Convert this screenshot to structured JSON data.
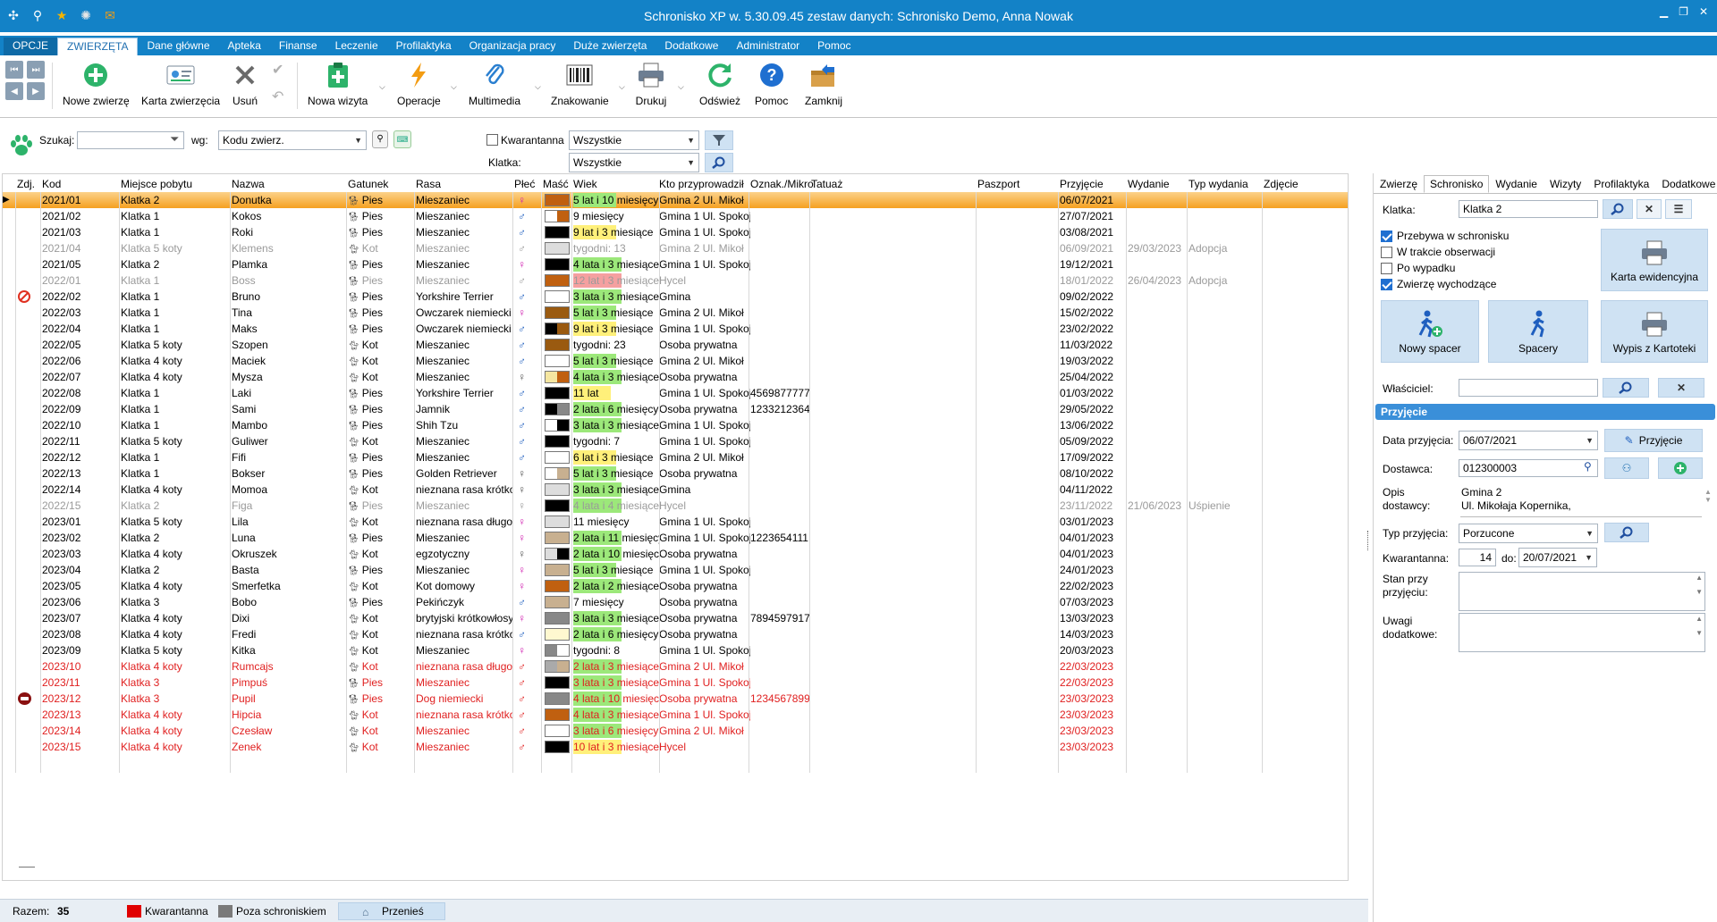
{
  "window": {
    "title": "Schronisko XP w. 5.30.09.45 zestaw danych: Schronisko Demo, Anna Nowak",
    "quick_icons": [
      "app-logo-icon",
      "search-icon",
      "star-icon",
      "settings-icon",
      "mail-icon"
    ]
  },
  "menu": {
    "tabs": [
      "OPCJE",
      "ZWIERZĘTA",
      "Dane główne",
      "Apteka",
      "Finanse",
      "Leczenie",
      "Profilaktyka",
      "Organizacja pracy",
      "Duże zwierzęta",
      "Dodatkowe",
      "Administrator",
      "Pomoc"
    ],
    "active": "ZWIERZĘTA"
  },
  "ribbon": {
    "new_animal": "Nowe zwierzę",
    "animal_card": "Karta zwierzęcia",
    "delete": "Usuń",
    "new_visit": "Nowa wizyta",
    "operations": "Operacje",
    "multimedia": "Multimedia",
    "labeling": "Znakowanie",
    "print": "Drukuj",
    "refresh": "Odśwież",
    "help": "Pomoc",
    "close": "Zamknij"
  },
  "search": {
    "search_label": "Szukaj:",
    "search_value": "",
    "by_label": "wg:",
    "by_value": "Kodu zwierz.",
    "quarantine_label": "Kwarantanna",
    "quarantine_value": "Wszystkie",
    "cage_label": "Klatka:",
    "cage_value": "Wszystkie"
  },
  "grid": {
    "columns": [
      "Zdj.",
      "Kod",
      "Miejsce pobytu",
      "Nazwa",
      "Gatunek",
      "Rasa",
      "Płeć",
      "Maść",
      "Wiek",
      "Kto przyprowadził",
      "Oznak./Mikro",
      "Tatuaż",
      "Paszport",
      "Przyjęcie",
      "Wydanie",
      "Typ wydania",
      "Zdjęcie"
    ],
    "rows": [
      {
        "kod": "2021/01",
        "miejsce": "Klatka 2",
        "nazwa": "Donutka",
        "gatunek": "Pies",
        "rasa": "Mieszaniec",
        "plec": "f",
        "masc": [
          "#c06010",
          "#c06010"
        ],
        "wiek": "5 lat i 10 miesięcy",
        "kto": "Gmina 2  Ul. Mikoł",
        "oznak": "",
        "przyjecie": "06/07/2021",
        "wydanie": "",
        "typ": "",
        "state": "sel",
        "icon": ""
      },
      {
        "kod": "2021/02",
        "miejsce": "Klatka 1",
        "nazwa": "Kokos",
        "gatunek": "Pies",
        "rasa": "Mieszaniec",
        "plec": "m",
        "masc": [
          "#ffffff",
          "#c06010"
        ],
        "wiek": "9 miesięcy",
        "kto": "Gmina 1  Ul. Spokoj",
        "oznak": "",
        "przyjecie": "27/07/2021",
        "wydanie": "",
        "typ": "",
        "state": "",
        "icon": ""
      },
      {
        "kod": "2021/03",
        "miejsce": "Klatka 1",
        "nazwa": "Roki",
        "gatunek": "Pies",
        "rasa": "Mieszaniec",
        "plec": "m",
        "masc": [
          "#000000",
          "#000000"
        ],
        "wiek": "9 lat i 3 miesiące",
        "kto": "Gmina 1  Ul. Spokoj",
        "oznak": "",
        "przyjecie": "03/08/2021",
        "wydanie": "",
        "typ": "",
        "state": "",
        "icon": ""
      },
      {
        "kod": "2021/04",
        "miejsce": "Klatka 5 koty",
        "nazwa": "Klemens",
        "gatunek": "Kot",
        "rasa": "Mieszaniec",
        "plec": "m",
        "masc": [
          "#dddddd",
          "#dddddd"
        ],
        "wiek": "tygodni: 13",
        "kto": "Gmina 2  Ul. Mikoł",
        "oznak": "",
        "przyjecie": "06/09/2021",
        "wydanie": "29/03/2023",
        "typ": "Adopcja",
        "state": "gray",
        "icon": ""
      },
      {
        "kod": "2021/05",
        "miejsce": "Klatka 2",
        "nazwa": "Plamka",
        "gatunek": "Pies",
        "rasa": "Mieszaniec",
        "plec": "f",
        "masc": [
          "#000000",
          "#000000"
        ],
        "wiek": "4 lata i 3 miesiące",
        "kto": "Gmina 1  Ul. Spokoj",
        "oznak": "",
        "przyjecie": "19/12/2021",
        "wydanie": "",
        "typ": "",
        "state": "",
        "icon": ""
      },
      {
        "kod": "2022/01",
        "miejsce": "Klatka 1",
        "nazwa": "Boss",
        "gatunek": "Pies",
        "rasa": "Mieszaniec",
        "plec": "m",
        "masc": [
          "#c06010",
          "#c06010"
        ],
        "wiek": "12 lat i 3 miesiące",
        "kto": "Hycel",
        "oznak": "",
        "przyjecie": "18/01/2022",
        "wydanie": "26/04/2023",
        "typ": "Adopcja",
        "state": "gray",
        "icon": ""
      },
      {
        "kod": "2022/02",
        "miejsce": "Klatka 1",
        "nazwa": "Bruno",
        "gatunek": "Pies",
        "rasa": "Yorkshire Terrier",
        "plec": "m",
        "masc": [
          "#ffffff",
          "#ffffff"
        ],
        "wiek": "3 lata i 3 miesiące",
        "kto": "Gmina",
        "oznak": "",
        "przyjecie": "09/02/2022",
        "wydanie": "",
        "typ": "",
        "state": "",
        "icon": "no"
      },
      {
        "kod": "2022/03",
        "miejsce": "Klatka 1",
        "nazwa": "Tina",
        "gatunek": "Pies",
        "rasa": "Owczarek niemiecki",
        "plec": "f",
        "masc": [
          "#9a5a10",
          "#9a5a10"
        ],
        "wiek": "5 lat i 3 miesiące",
        "kto": "Gmina 2  Ul. Mikoł",
        "oznak": "",
        "przyjecie": "15/02/2022",
        "wydanie": "",
        "typ": "",
        "state": "",
        "icon": ""
      },
      {
        "kod": "2022/04",
        "miejsce": "Klatka 1",
        "nazwa": "Maks",
        "gatunek": "Pies",
        "rasa": "Owczarek niemiecki",
        "plec": "m",
        "masc": [
          "#000000",
          "#9a5a10"
        ],
        "wiek": "9 lat i 3 miesiące",
        "kto": "Gmina 1  Ul. Spokoj",
        "oznak": "",
        "przyjecie": "23/02/2022",
        "wydanie": "",
        "typ": "",
        "state": "",
        "icon": ""
      },
      {
        "kod": "2022/05",
        "miejsce": "Klatka 5 koty",
        "nazwa": "Szopen",
        "gatunek": "Kot",
        "rasa": "Mieszaniec",
        "plec": "m",
        "masc": [
          "#9a5a10",
          "#9a5a10"
        ],
        "wiek": "tygodni: 23",
        "kto": "Osoba prywatna",
        "oznak": "",
        "przyjecie": "11/03/2022",
        "wydanie": "",
        "typ": "",
        "state": "",
        "icon": ""
      },
      {
        "kod": "2022/06",
        "miejsce": "Klatka 4 koty",
        "nazwa": "Maciek",
        "gatunek": "Kot",
        "rasa": "Mieszaniec",
        "plec": "m",
        "masc": [
          "#ffffff",
          "#ffffff"
        ],
        "wiek": "5 lat i 3 miesiące",
        "kto": "Gmina 2  Ul. Mikoł",
        "oznak": "",
        "przyjecie": "19/03/2022",
        "wydanie": "",
        "typ": "",
        "state": "",
        "icon": ""
      },
      {
        "kod": "2022/07",
        "miejsce": "Klatka 4 koty",
        "nazwa": "Mysza",
        "gatunek": "Kot",
        "rasa": "Mieszaniec",
        "plec": "u",
        "masc": [
          "#f5e6a0",
          "#c06010"
        ],
        "wiek": "4 lata i 3 miesiące",
        "kto": "Osoba prywatna",
        "oznak": "",
        "przyjecie": "25/04/2022",
        "wydanie": "",
        "typ": "",
        "state": "",
        "icon": ""
      },
      {
        "kod": "2022/08",
        "miejsce": "Klatka 1",
        "nazwa": "Laki",
        "gatunek": "Pies",
        "rasa": "Yorkshire Terrier",
        "plec": "m",
        "masc": [
          "#000000",
          "#000000"
        ],
        "wiek": "11 lat",
        "kto": "Gmina 1  Ul. Spokoj",
        "oznak": "4569877777",
        "przyjecie": "01/03/2022",
        "wydanie": "",
        "typ": "",
        "state": "",
        "icon": ""
      },
      {
        "kod": "2022/09",
        "miejsce": "Klatka 1",
        "nazwa": "Sami",
        "gatunek": "Pies",
        "rasa": "Jamnik",
        "plec": "m",
        "masc": [
          "#000000",
          "#888888"
        ],
        "wiek": "2 lata i 6 miesięcy",
        "kto": "Osoba prywatna",
        "oznak": "1233212364",
        "przyjecie": "29/05/2022",
        "wydanie": "",
        "typ": "",
        "state": "",
        "icon": ""
      },
      {
        "kod": "2022/10",
        "miejsce": "Klatka 1",
        "nazwa": "Mambo",
        "gatunek": "Pies",
        "rasa": "Shih Tzu",
        "plec": "m",
        "masc": [
          "#ffffff",
          "#000000"
        ],
        "wiek": "3 lata i 3 miesiące",
        "kto": "Gmina 1  Ul. Spokoj",
        "oznak": "",
        "przyjecie": "13/06/2022",
        "wydanie": "",
        "typ": "",
        "state": "",
        "icon": ""
      },
      {
        "kod": "2022/11",
        "miejsce": "Klatka 5 koty",
        "nazwa": "Guliwer",
        "gatunek": "Kot",
        "rasa": "Mieszaniec",
        "plec": "m",
        "masc": [
          "#000000",
          "#000000"
        ],
        "wiek": "tygodni: 7",
        "kto": "Gmina 1  Ul. Spokoj",
        "oznak": "",
        "przyjecie": "05/09/2022",
        "wydanie": "",
        "typ": "",
        "state": "",
        "icon": ""
      },
      {
        "kod": "2022/12",
        "miejsce": "Klatka 1",
        "nazwa": "Fifi",
        "gatunek": "Pies",
        "rasa": "Mieszaniec",
        "plec": "m",
        "masc": [
          "#ffffff",
          "#ffffff"
        ],
        "wiek": "6 lat i 3 miesiące",
        "kto": "Gmina 2  Ul. Mikoł",
        "oznak": "",
        "przyjecie": "17/09/2022",
        "wydanie": "",
        "typ": "",
        "state": "",
        "icon": ""
      },
      {
        "kod": "2022/13",
        "miejsce": "Klatka 1",
        "nazwa": "Bokser",
        "gatunek": "Pies",
        "rasa": "Golden Retriever",
        "plec": "u",
        "masc": [
          "#ffffff",
          "#c8b090"
        ],
        "wiek": "5 lat i 3 miesiące",
        "kto": "Osoba prywatna",
        "oznak": "",
        "przyjecie": "08/10/2022",
        "wydanie": "",
        "typ": "",
        "state": "",
        "icon": ""
      },
      {
        "kod": "2022/14",
        "miejsce": "Klatka 4 koty",
        "nazwa": "Momoa",
        "gatunek": "Kot",
        "rasa": "nieznana rasa krótkowł.",
        "plec": "u",
        "masc": [
          "#dddddd",
          "#dddddd"
        ],
        "wiek": "3 lata i 3 miesiące",
        "kto": "Gmina",
        "oznak": "",
        "przyjecie": "04/11/2022",
        "wydanie": "",
        "typ": "",
        "state": "",
        "icon": ""
      },
      {
        "kod": "2022/15",
        "miejsce": "Klatka 2",
        "nazwa": "Figa",
        "gatunek": "Pies",
        "rasa": "Mieszaniec",
        "plec": "f",
        "masc": [
          "#000000",
          "#000000"
        ],
        "wiek": "4 lata i 4 miesiące",
        "kto": "Hycel",
        "oznak": "",
        "przyjecie": "23/11/2022",
        "wydanie": "21/06/2023",
        "typ": "Uśpienie",
        "state": "gray",
        "icon": ""
      },
      {
        "kod": "2023/01",
        "miejsce": "Klatka 5 koty",
        "nazwa": "Lila",
        "gatunek": "Kot",
        "rasa": "nieznana rasa długowł.",
        "plec": "f",
        "masc": [
          "#dddddd",
          "#dddddd"
        ],
        "wiek": "11 miesięcy",
        "kto": "Gmina 1  Ul. Spokoj",
        "oznak": "",
        "przyjecie": "03/01/2023",
        "wydanie": "",
        "typ": "",
        "state": "",
        "icon": ""
      },
      {
        "kod": "2023/02",
        "miejsce": "Klatka 2",
        "nazwa": "Luna",
        "gatunek": "Pies",
        "rasa": "Mieszaniec",
        "plec": "f",
        "masc": [
          "#c8b090",
          "#c8b090"
        ],
        "wiek": "2 lata i 11 miesięcy",
        "kto": "Gmina 1  Ul. Spokoj",
        "oznak": "1223654111",
        "przyjecie": "04/01/2023",
        "wydanie": "",
        "typ": "",
        "state": "",
        "icon": ""
      },
      {
        "kod": "2023/03",
        "miejsce": "Klatka 4 koty",
        "nazwa": "Okruszek",
        "gatunek": "Kot",
        "rasa": "egzotyczny",
        "plec": "u",
        "masc": [
          "#dddddd",
          "#000000"
        ],
        "wiek": "2 lata i 10 miesięcy",
        "kto": "Osoba prywatna",
        "oznak": "",
        "przyjecie": "04/01/2023",
        "wydanie": "",
        "typ": "",
        "state": "",
        "icon": ""
      },
      {
        "kod": "2023/04",
        "miejsce": "Klatka 2",
        "nazwa": "Basta",
        "gatunek": "Pies",
        "rasa": "Mieszaniec",
        "plec": "f",
        "masc": [
          "#c8b090",
          "#c8b090"
        ],
        "wiek": "5 lat i 3 miesiące",
        "kto": "Gmina 1  Ul. Spokoj",
        "oznak": "",
        "przyjecie": "24/01/2023",
        "wydanie": "",
        "typ": "",
        "state": "",
        "icon": ""
      },
      {
        "kod": "2023/05",
        "miejsce": "Klatka 4 koty",
        "nazwa": "Smerfetka",
        "gatunek": "Kot",
        "rasa": "Kot domowy",
        "plec": "f",
        "masc": [
          "#c06010",
          "#c06010"
        ],
        "wiek": "2 lata i 2 miesiące",
        "kto": "Osoba prywatna",
        "oznak": "",
        "przyjecie": "22/02/2023",
        "wydanie": "",
        "typ": "",
        "state": "",
        "icon": ""
      },
      {
        "kod": "2023/06",
        "miejsce": "Klatka 3",
        "nazwa": "Bobo",
        "gatunek": "Pies",
        "rasa": "Pekińczyk",
        "plec": "m",
        "masc": [
          "#c8b090",
          "#c8b090"
        ],
        "wiek": "7 miesięcy",
        "kto": "Osoba prywatna",
        "oznak": "",
        "przyjecie": "07/03/2023",
        "wydanie": "",
        "typ": "",
        "state": "",
        "icon": ""
      },
      {
        "kod": "2023/07",
        "miejsce": "Klatka 4 koty",
        "nazwa": "Dixi",
        "gatunek": "Kot",
        "rasa": "brytyjski krótkowłosy",
        "plec": "f",
        "masc": [
          "#888888",
          "#888888"
        ],
        "wiek": "3 lata i 3 miesiące",
        "kto": "Osoba prywatna",
        "oznak": "7894597917",
        "przyjecie": "13/03/2023",
        "wydanie": "",
        "typ": "",
        "state": "",
        "icon": ""
      },
      {
        "kod": "2023/08",
        "miejsce": "Klatka 4 koty",
        "nazwa": "Fredi",
        "gatunek": "Kot",
        "rasa": "nieznana rasa krótkowł.",
        "plec": "m",
        "masc": [
          "#fff8d0",
          "#fff8d0"
        ],
        "wiek": "2 lata i 6 miesięcy",
        "kto": "Osoba prywatna",
        "oznak": "",
        "przyjecie": "14/03/2023",
        "wydanie": "",
        "typ": "",
        "state": "",
        "icon": ""
      },
      {
        "kod": "2023/09",
        "miejsce": "Klatka 5 koty",
        "nazwa": "Kitka",
        "gatunek": "Kot",
        "rasa": "Mieszaniec",
        "plec": "f",
        "masc": [
          "#888888",
          "#ffffff"
        ],
        "wiek": "tygodni: 8",
        "kto": "Gmina 1  Ul. Spokoj",
        "oznak": "",
        "przyjecie": "20/03/2023",
        "wydanie": "",
        "typ": "",
        "state": "",
        "icon": ""
      },
      {
        "kod": "2023/10",
        "miejsce": "Klatka 4 koty",
        "nazwa": "Rumcajs",
        "gatunek": "Kot",
        "rasa": "nieznana rasa długowł.",
        "plec": "m",
        "masc": [
          "#aaaaaa",
          "#c8b090"
        ],
        "wiek": "2 lata i 3 miesiące",
        "kto": "Gmina 2  Ul. Mikoł",
        "oznak": "",
        "przyjecie": "22/03/2023",
        "wydanie": "",
        "typ": "",
        "state": "red",
        "icon": ""
      },
      {
        "kod": "2023/11",
        "miejsce": "Klatka 3",
        "nazwa": "Pimpuś",
        "gatunek": "Pies",
        "rasa": "Mieszaniec",
        "plec": "m",
        "masc": [
          "#000000",
          "#000000"
        ],
        "wiek": "3 lata i 3 miesiące",
        "kto": "Gmina 1  Ul. Spokoj",
        "oznak": "",
        "przyjecie": "22/03/2023",
        "wydanie": "",
        "typ": "",
        "state": "red",
        "icon": ""
      },
      {
        "kod": "2023/12",
        "miejsce": "Klatka 3",
        "nazwa": "Pupil",
        "gatunek": "Pies",
        "rasa": "Dog niemiecki",
        "plec": "m",
        "masc": [
          "#888888",
          "#888888"
        ],
        "wiek": "4 lata i 10 miesięcy",
        "kto": "Osoba prywatna",
        "oznak": "1234567899",
        "przyjecie": "23/03/2023",
        "wydanie": "",
        "typ": "",
        "state": "red",
        "icon": "bite"
      },
      {
        "kod": "2023/13",
        "miejsce": "Klatka 4 koty",
        "nazwa": "Hipcia",
        "gatunek": "Kot",
        "rasa": "nieznana rasa krótkowł.",
        "plec": "m",
        "masc": [
          "#c06010",
          "#c06010"
        ],
        "wiek": "4 lata i 3 miesiące",
        "kto": "Gmina 1  Ul. Spokoj",
        "oznak": "",
        "przyjecie": "23/03/2023",
        "wydanie": "",
        "typ": "",
        "state": "red",
        "icon": ""
      },
      {
        "kod": "2023/14",
        "miejsce": "Klatka 4 koty",
        "nazwa": "Czesław",
        "gatunek": "Kot",
        "rasa": "Mieszaniec",
        "plec": "m",
        "masc": [
          "#ffffff",
          "#ffffff"
        ],
        "wiek": "3 lata i 6 miesięcy",
        "kto": "Gmina 2  Ul. Mikoł",
        "oznak": "",
        "przyjecie": "23/03/2023",
        "wydanie": "",
        "typ": "",
        "state": "red",
        "icon": ""
      },
      {
        "kod": "2023/15",
        "miejsce": "Klatka 4 koty",
        "nazwa": "Zenek",
        "gatunek": "Kot",
        "rasa": "Mieszaniec",
        "plec": "m",
        "masc": [
          "#000000",
          "#000000"
        ],
        "wiek": "10 lat i 3 miesiące",
        "kto": "Hycel",
        "oznak": "",
        "przyjecie": "23/03/2023",
        "wydanie": "",
        "typ": "",
        "state": "red",
        "icon": ""
      }
    ]
  },
  "status": {
    "total_label": "Razem:",
    "total_value": "35",
    "legend_quarantine": "Kwarantanna",
    "legend_outside": "Poza schroniskiem",
    "move_button": "Przenieś",
    "quarantine_color": "#e00000",
    "outside_color": "#7a7a7a"
  },
  "panel": {
    "tabs": [
      "Zwierzę",
      "Schronisko",
      "Wydanie",
      "Wizyty",
      "Profilaktyka",
      "Dodatkowe"
    ],
    "active_tab": "Schronisko",
    "cage_label": "Klatka:",
    "cage_value": "Klatka 2",
    "chk_in_shelter": "Przebywa w schronisku",
    "chk_observation": "W trakcie obserwacji",
    "chk_accident": "Po wypadku",
    "chk_outgoing": "Zwierzę wychodzące",
    "chk_in_shelter_on": true,
    "chk_observation_on": false,
    "chk_accident_on": false,
    "chk_outgoing_on": true,
    "records_card": "Karta ewidencyjna",
    "new_walk": "Nowy spacer",
    "walks": "Spacery",
    "card_index": "Wypis z Kartoteki",
    "owner_label": "Właściciel:",
    "owner_value": "",
    "section": "Przyjęcie",
    "admission_date_label": "Data przyjęcia:",
    "admission_date_value": "06/07/2021",
    "admission_button": "Przyjęcie",
    "supplier_label": "Dostawca:",
    "supplier_value": "012300003",
    "supplier_desc_label": "Opis dostawcy:",
    "supplier_desc_line1": "Gmina 2",
    "supplier_desc_line2": "Ul. Mikołaja Kopernika,",
    "admission_type_label": "Typ przyjęcia:",
    "admission_type_value": "Porzucone",
    "quarantine_label": "Kwarantanna:",
    "quarantine_days": "14",
    "quarantine_to_label": "do:",
    "quarantine_to_value": "20/07/2021",
    "condition_label": "Stan przy przyjęciu:",
    "notes_label": "Uwagi dodatkowe:"
  }
}
